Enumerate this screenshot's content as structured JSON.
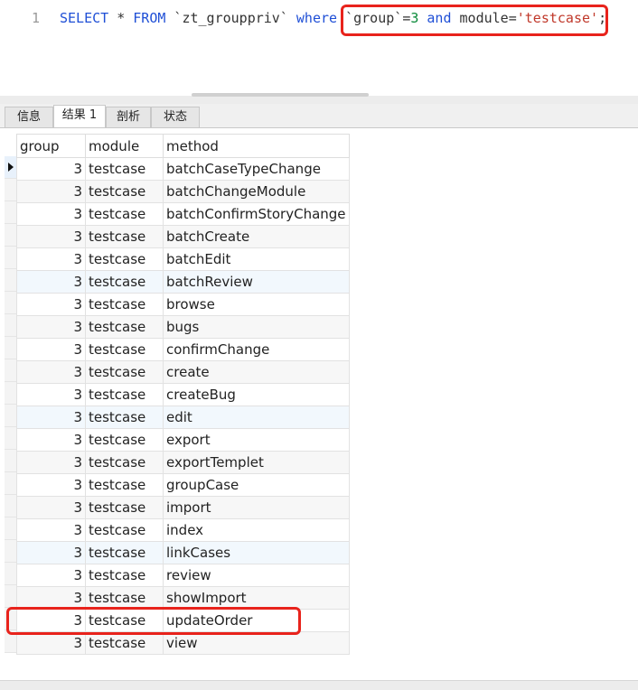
{
  "editor": {
    "line_number": "1",
    "sql": {
      "select": "SELECT",
      "star": " * ",
      "from": "FROM",
      "table": " `zt_grouppriv` ",
      "where": "where",
      "space": " ",
      "group_col": "`group`",
      "eq1": "=",
      "group_val": "3",
      "and": " and ",
      "module_col": "module",
      "eq2": "=",
      "module_val": "'testcase'",
      "end": ";"
    }
  },
  "tabs": [
    {
      "label": "信息"
    },
    {
      "label": "结果 1"
    },
    {
      "label": "剖析"
    },
    {
      "label": "状态"
    }
  ],
  "active_tab": "结果 1",
  "grid": {
    "columns": [
      "group",
      "module",
      "method"
    ],
    "rows": [
      [
        "3",
        "testcase",
        "batchCaseTypeChange"
      ],
      [
        "3",
        "testcase",
        "batchChangeModule"
      ],
      [
        "3",
        "testcase",
        "batchConfirmStoryChange"
      ],
      [
        "3",
        "testcase",
        "batchCreate"
      ],
      [
        "3",
        "testcase",
        "batchEdit"
      ],
      [
        "3",
        "testcase",
        "batchReview"
      ],
      [
        "3",
        "testcase",
        "browse"
      ],
      [
        "3",
        "testcase",
        "bugs"
      ],
      [
        "3",
        "testcase",
        "confirmChange"
      ],
      [
        "3",
        "testcase",
        "create"
      ],
      [
        "3",
        "testcase",
        "createBug"
      ],
      [
        "3",
        "testcase",
        "edit"
      ],
      [
        "3",
        "testcase",
        "export"
      ],
      [
        "3",
        "testcase",
        "exportTemplet"
      ],
      [
        "3",
        "testcase",
        "groupCase"
      ],
      [
        "3",
        "testcase",
        "import"
      ],
      [
        "3",
        "testcase",
        "index"
      ],
      [
        "3",
        "testcase",
        "linkCases"
      ],
      [
        "3",
        "testcase",
        "review"
      ],
      [
        "3",
        "testcase",
        "showImport"
      ],
      [
        "3",
        "testcase",
        "updateOrder"
      ],
      [
        "3",
        "testcase",
        "view"
      ]
    ]
  },
  "colors": {
    "highlight": "#e8231c",
    "keyword": "#1f4fd6",
    "string": "#c0392b",
    "number": "#0b8a3a"
  },
  "icons": {
    "current_row": "current-row-arrow-icon"
  }
}
